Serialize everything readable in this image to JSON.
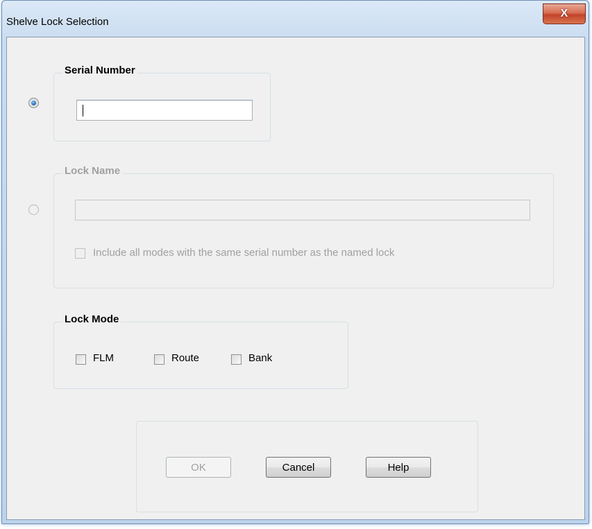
{
  "window": {
    "title": "Shelve Lock Selection",
    "close_glyph": "X"
  },
  "serial_number": {
    "legend": "Serial Number",
    "value": "",
    "selected": true
  },
  "lock_name": {
    "legend": "Lock Name",
    "value": "",
    "selected": false,
    "enabled": false,
    "include_all_label": "Include all modes with the same serial number as the named lock"
  },
  "lock_mode": {
    "legend": "Lock Mode",
    "options": [
      {
        "label": "FLM",
        "checked": false
      },
      {
        "label": "Route",
        "checked": false
      },
      {
        "label": "Bank",
        "checked": false
      }
    ]
  },
  "buttons": {
    "ok": "OK",
    "cancel": "Cancel",
    "help": "Help"
  },
  "colors": {
    "dialog_bg": "#f0f0f0",
    "title_bar": "#c9dcf1",
    "close_button": "#c2432a",
    "disabled_text": "#a0a0a0"
  }
}
